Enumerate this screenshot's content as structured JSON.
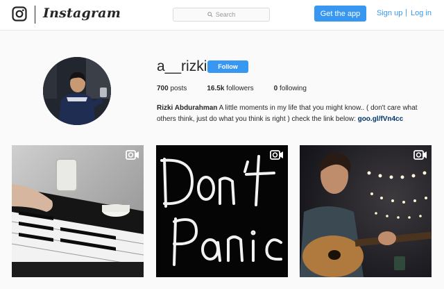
{
  "header": {
    "brand": "Instagram",
    "search_placeholder": "Search",
    "get_app_label": "Get the app",
    "signup_label": "Sign up",
    "separator": "|",
    "login_label": "Log in"
  },
  "profile": {
    "username": "a__rizki",
    "follow_label": "Follow",
    "posts_count": "700",
    "posts_label": " posts",
    "followers_count": "16.5k",
    "followers_label": " followers",
    "following_count": "0",
    "following_label": " following",
    "full_name": "Rizki Abdurahman",
    "bio_text": " A little moments in my life that you might know.. ( don't care what others think, just do what you think is right ) check the link below: ",
    "bio_link": "goo.gl/fVn4cc"
  },
  "posts": [
    {
      "subject": "piano keys",
      "type": "video"
    },
    {
      "subject": "handwritten Don't Panic",
      "type": "video",
      "text_line1": "Don't",
      "text_line2": "Panic"
    },
    {
      "subject": "man playing guitar",
      "type": "video"
    }
  ],
  "colors": {
    "accent": "#3897f0",
    "link": "#003569",
    "text": "#262626",
    "background": "#fafafa"
  }
}
